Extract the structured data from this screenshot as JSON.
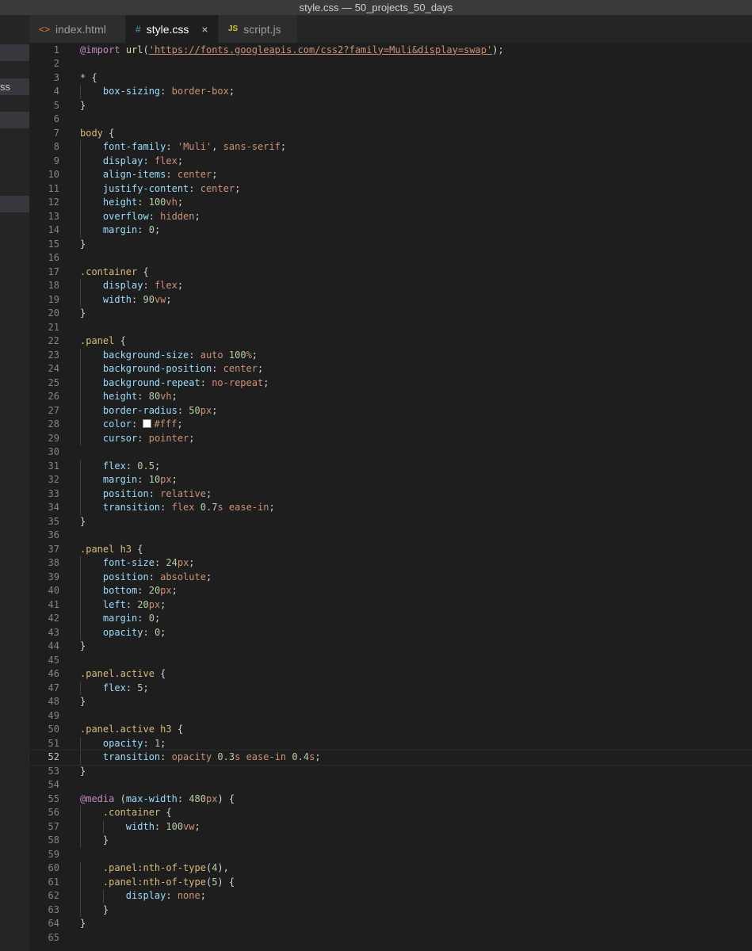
{
  "window": {
    "title": "style.css — 50_projects_50_days"
  },
  "sidebar": {
    "partial_label": "ss"
  },
  "tabs": [
    {
      "icon": "<>",
      "label": "index.html"
    },
    {
      "icon": "#",
      "label": "style.css",
      "close": "×"
    },
    {
      "icon": "JS",
      "label": "script.js"
    }
  ],
  "editor": {
    "current_line": 52,
    "colors": {
      "swatch_color": "#fff"
    },
    "lines": [
      "@import url('https://fonts.googleapis.com/css2?family=Muli&display=swap');",
      "",
      "* {",
      "    box-sizing: border-box;",
      "}",
      "",
      "body {",
      "    font-family: 'Muli', sans-serif;",
      "    display: flex;",
      "    align-items: center;",
      "    justify-content: center;",
      "    height: 100vh;",
      "    overflow: hidden;",
      "    margin: 0;",
      "}",
      "",
      ".container {",
      "    display: flex;",
      "    width: 90vw;",
      "}",
      "",
      ".panel {",
      "    background-size: auto 100%;",
      "    background-position: center;",
      "    background-repeat: no-repeat;",
      "    height: 80vh;",
      "    border-radius: 50px;",
      "    color: #fff;",
      "    cursor: pointer;",
      "",
      "    flex: 0.5;",
      "    margin: 10px;",
      "    position: relative;",
      "    transition: flex 0.7s ease-in;",
      "}",
      "",
      ".panel h3 {",
      "    font-size: 24px;",
      "    position: absolute;",
      "    bottom: 20px;",
      "    left: 20px;",
      "    margin: 0;",
      "    opacity: 0;",
      "}",
      "",
      ".panel.active {",
      "    flex: 5;",
      "}",
      "",
      ".panel.active h3 {",
      "    opacity: 1;",
      "    transition: opacity 0.3s ease-in 0.4s;",
      "}",
      "",
      "@media (max-width: 480px) {",
      "    .container {",
      "        width: 100vw;",
      "    }",
      "",
      "    .panel:nth-of-type(4),",
      "    .panel:nth-of-type(5) {",
      "        display: none;",
      "    }",
      "}",
      ""
    ]
  }
}
